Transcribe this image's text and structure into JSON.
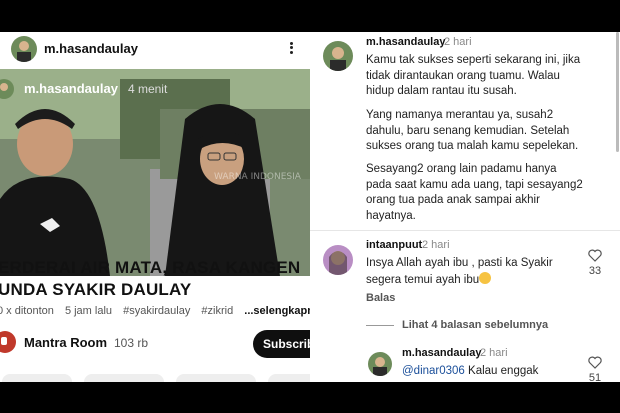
{
  "left": {
    "header_username": "m.hasandaulay",
    "video": {
      "overlay_username": "m.hasandaulay",
      "overlay_time": "4 menit",
      "watermark": "WARNA INDONESIA"
    },
    "title_line1": "ERDERAI AIR MATA, RASA KANGEN",
    "title_line2": "UNDA SYAKIR DAULAY",
    "meta": {
      "views": "0 x ditonton",
      "uploaded": "5 jam lalu",
      "tag1": "#syakirdaulay",
      "tag2": "#zikrid",
      "more": "...selengkapnya"
    },
    "channel": {
      "name": "Mantra Room",
      "subs": "103 rb",
      "subscribe_label": "Subscribe"
    }
  },
  "right": {
    "post": {
      "username": "m.hasandaulay",
      "time": "2 hari",
      "para1": [
        "Kamu tak sukses seperti sekarang ini, jika",
        "tidak dirantaukan orang tuamu. Walau",
        "hidup dalam rantau itu susah."
      ],
      "para2": [
        "Yang namanya merantau ya, susah2",
        "dahulu, baru senang kemudian. Setelah",
        "sukses orang tua malah kamu sepelekan."
      ],
      "para3": [
        "Sesayang2 orang lain padamu hanya",
        "pada saat kamu ada uang, tapi sesayang2",
        "orang tua pada anak sampai akhir",
        "hayatnya."
      ]
    },
    "comment1": {
      "username": "intaanpuut",
      "time": "2 hari",
      "line1": "Insya Allah ayah ibu , pasti ka Syakir",
      "line2": "segera temui ayah ibu",
      "reply_label": "Balas",
      "likes": "33"
    },
    "view_replies": "Lihat 4 balasan sebelumnya",
    "reply": {
      "username": "m.hasandaulay",
      "time": "2 hari",
      "mention": "@dinar0306",
      "text": " Kalau enggak",
      "likes": "51"
    }
  }
}
